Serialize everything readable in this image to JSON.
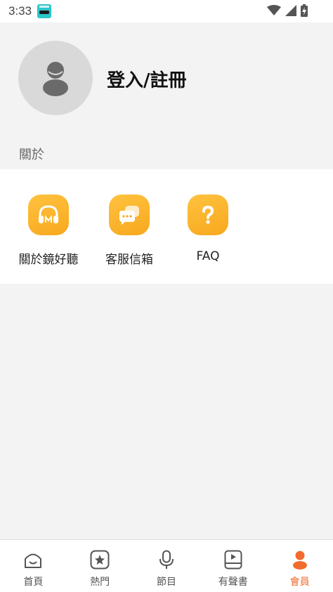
{
  "status_bar": {
    "time": "3:33",
    "icons": [
      "app-notification-icon",
      "wifi-icon",
      "cell-signal-icon",
      "battery-charging-icon"
    ]
  },
  "profile": {
    "avatar_icon": "user-avatar-icon",
    "login_label": "登入/註冊"
  },
  "about_section": {
    "title": "關於",
    "items": [
      {
        "label": "關於鏡好聽",
        "icon": "headphones-icon"
      },
      {
        "label": "客服信箱",
        "icon": "chat-bubbles-icon"
      },
      {
        "label": "FAQ",
        "icon": "question-icon"
      }
    ]
  },
  "bottom_nav": {
    "items": [
      {
        "label": "首頁",
        "icon": "home-icon",
        "active": false
      },
      {
        "label": "熱門",
        "icon": "star-icon",
        "active": false
      },
      {
        "label": "節目",
        "icon": "microphone-icon",
        "active": false
      },
      {
        "label": "有聲書",
        "icon": "book-play-icon",
        "active": false
      },
      {
        "label": "會員",
        "icon": "member-icon",
        "active": true
      }
    ]
  },
  "colors": {
    "accent": "#f26b2c",
    "icon_gradient_start": "#ffc23f",
    "icon_gradient_end": "#f8a81e",
    "background": "#f3f3f3"
  }
}
